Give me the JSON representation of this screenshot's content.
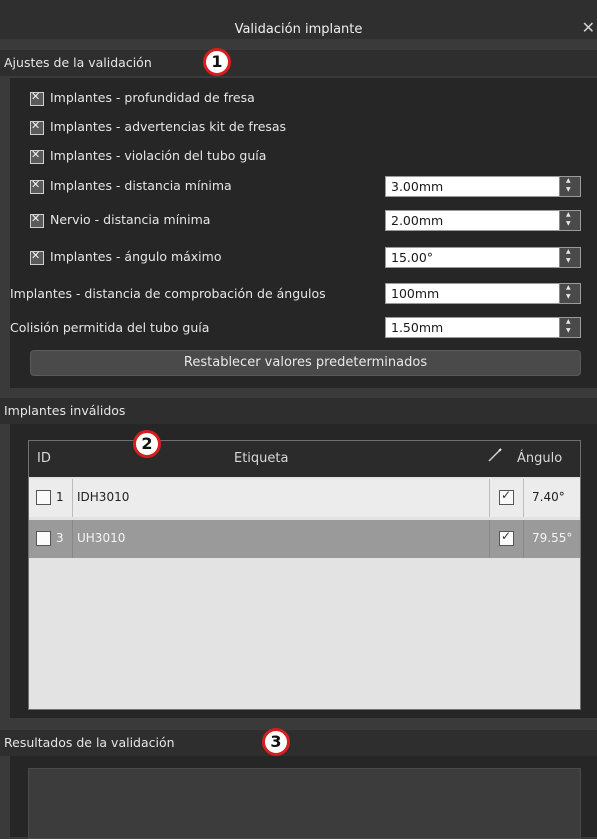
{
  "window": {
    "title": "Validación implante"
  },
  "settings": {
    "header": "Ajustes de la validación",
    "badge": "1",
    "checks": [
      {
        "label": "Implantes - profundidad de fresa"
      },
      {
        "label": "Implantes - advertencias kit de fresas"
      },
      {
        "label": "Implantes - violación del tubo guía"
      },
      {
        "label": "Implantes - distancia mínima",
        "value": "3.00mm"
      },
      {
        "label": "Nervio - distancia mínima",
        "value": "2.00mm"
      },
      {
        "label": "Implantes - ángulo máximo",
        "value": "15.00°"
      }
    ],
    "plain": [
      {
        "label": "Implantes - distancia de comprobación de ángulos",
        "value": "100mm"
      },
      {
        "label": "Colisión permitida del tubo guía",
        "value": "1.50mm"
      }
    ],
    "reset_label": "Restablecer valores predeterminados"
  },
  "invalid": {
    "header": "Implantes inválidos",
    "badge": "2",
    "columns": {
      "id": "ID",
      "label": "Etiqueta",
      "angle": "Ángulo"
    },
    "rows": [
      {
        "id": "1",
        "label": "IDH3010",
        "angle": "7.40°",
        "checked": true,
        "selected": false
      },
      {
        "id": "3",
        "label": "UH3010",
        "angle": "79.55°",
        "checked": true,
        "selected": true
      }
    ]
  },
  "results": {
    "header": "Resultados de la validación",
    "badge": "3"
  },
  "icons": {
    "close": "close-icon",
    "edit": "pencil-icon",
    "spin": "spinner-arrows-icon"
  },
  "colors": {
    "badge_border": "#d61e1e",
    "selected_row": "#9a9a9a"
  }
}
